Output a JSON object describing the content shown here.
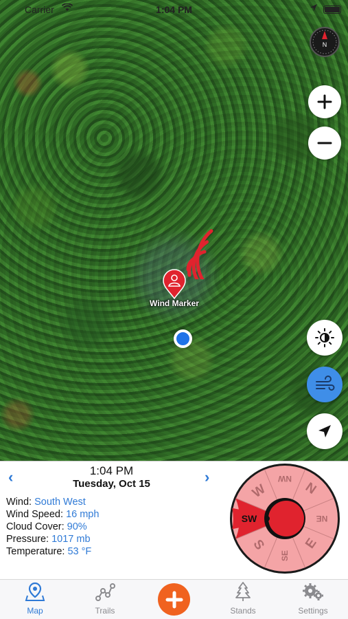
{
  "status_bar": {
    "carrier": "Carrier",
    "time": "1:04 PM"
  },
  "map": {
    "marker_label": "Wind Marker",
    "compass_label": "N",
    "colors": {
      "wind_arcs": "#e0232e",
      "user_dot": "#1f73e8",
      "wind_button": "#3f8ee8"
    },
    "icons": [
      "compass-icon",
      "plus-icon",
      "minus-icon",
      "brightness-icon",
      "wind-icon",
      "location-arrow-icon"
    ]
  },
  "info": {
    "time": "1:04 PM",
    "date": "Tuesday, Oct 15",
    "prev": "‹",
    "next": "›",
    "stats": [
      {
        "label": "Wind:",
        "value": "South West"
      },
      {
        "label": "Wind Speed:",
        "value": "16 mph"
      },
      {
        "label": "Cloud Cover:",
        "value": "90%"
      },
      {
        "label": "Pressure:",
        "value": "1017 mb"
      },
      {
        "label": "Temperature:",
        "value": "53 °F"
      }
    ]
  },
  "wind_compass": {
    "active_direction": "SW",
    "directions": [
      "N",
      "NE",
      "E",
      "SE",
      "S",
      "SW",
      "W",
      "NW"
    ],
    "colors": {
      "ring": "#f4a4a6",
      "active": "#e0232e",
      "center": "#e0232e"
    }
  },
  "tabbar": {
    "tabs": [
      {
        "label": "Map",
        "icon": "map-pin-icon",
        "active": true
      },
      {
        "label": "Trails",
        "icon": "trail-path-icon",
        "active": false
      },
      {
        "label": "Stands",
        "icon": "tree-icon",
        "active": false
      },
      {
        "label": "Settings",
        "icon": "gear-icon",
        "active": false
      }
    ],
    "add_icon": "plus-icon",
    "colors": {
      "active": "#2f7ad6",
      "add_button": "#f0621f"
    }
  }
}
